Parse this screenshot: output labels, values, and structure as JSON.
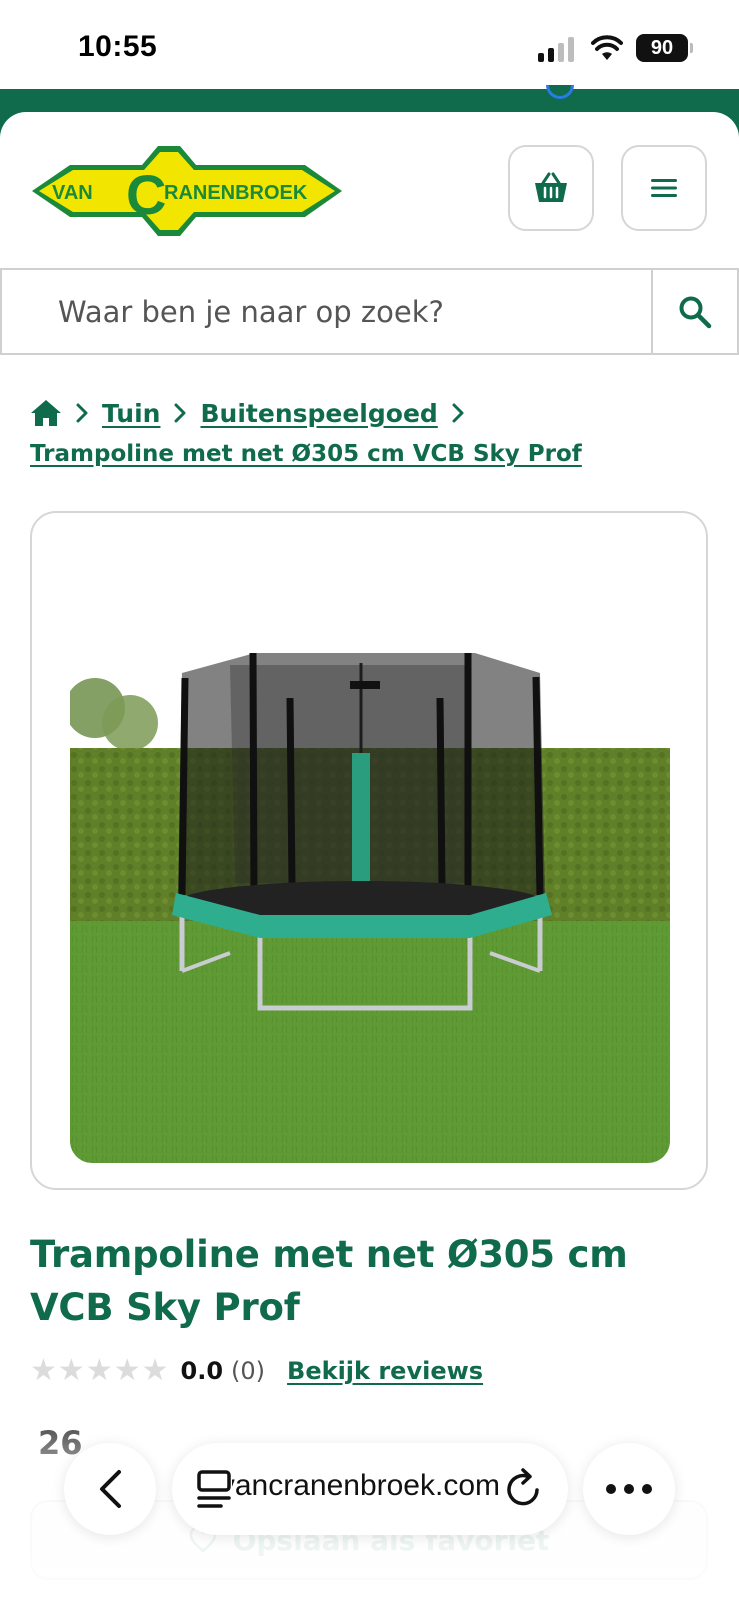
{
  "status_bar": {
    "time": "10:55",
    "battery": "90"
  },
  "header": {
    "logo_text": "VANCRANENBROEK",
    "cart_icon": "basket-icon",
    "menu_icon": "hamburger-menu-icon"
  },
  "search": {
    "placeholder": "Waar ben je naar op zoek?"
  },
  "breadcrumb": {
    "items": [
      {
        "label": "Tuin"
      },
      {
        "label": "Buitenspeelgoed"
      },
      {
        "label": "Trampoline met net Ø305 cm VCB Sky Prof"
      }
    ]
  },
  "product": {
    "title": "Trampoline met net Ø305 cm VCB Sky Prof",
    "rating": {
      "value": "0.0",
      "count": "(0)",
      "stars_filled": 0,
      "stars_total": 5,
      "reviews_link": "Bekijk reviews"
    },
    "price_partial": "26",
    "favorite_label": "Opslaan als favoriet"
  },
  "browser": {
    "url": "vancranenbroek.com"
  },
  "colors": {
    "brand_green": "#0f6b4c",
    "logo_yellow": "#f2e600",
    "logo_green": "#1a8a3a"
  }
}
